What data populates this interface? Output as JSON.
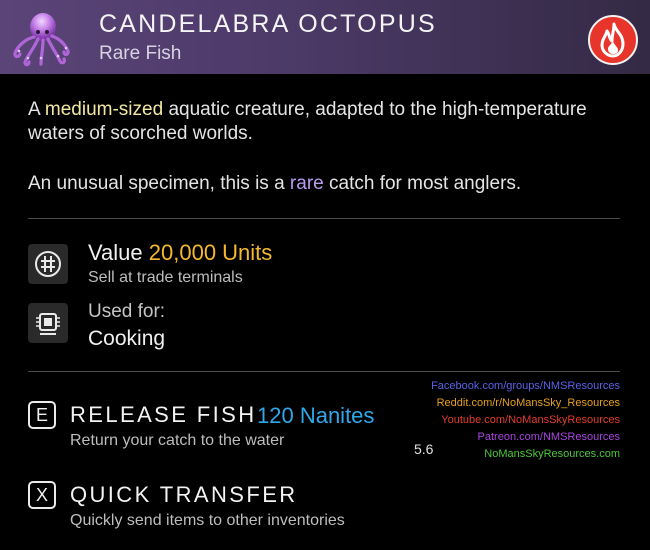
{
  "item": {
    "title": "CANDELABRA OCTOPUS",
    "subtitle": "Rare Fish",
    "icon": "octopus-icon",
    "badge_icon": "heat-flame-icon",
    "header_color": "#5b4478"
  },
  "description": {
    "p1_pre": "A ",
    "p1_hl": "medium-sized",
    "p1_post": " aquatic creature, adapted to the high-temperature waters of scorched worlds.",
    "p2_pre": "An unusual specimen, this is a ",
    "p2_hl": "rare",
    "p2_post": " catch for most anglers."
  },
  "value": {
    "label": "Value",
    "amount": "20,000 Units",
    "sub": "Sell at trade terminals",
    "icon": "units-currency-icon"
  },
  "used_for": {
    "label": "Used for:",
    "value": "Cooking",
    "icon": "nutrient-processor-icon"
  },
  "actions": [
    {
      "key": "E",
      "label": "RELEASE FISH",
      "sub": "Return your catch to the water",
      "reward": "120 Nanites"
    },
    {
      "key": "X",
      "label": "QUICK TRANSFER",
      "sub": "Quickly send items to other inventories"
    }
  ],
  "credits": [
    {
      "text": "Facebook.com/groups/NMSResources",
      "color": "#5a62e6"
    },
    {
      "text": "Reddit.com/r/NoMansSky_Resources",
      "color": "#e6a020"
    },
    {
      "text": "Youtube.com/NoMansSkyResources",
      "color": "#e23c2c"
    },
    {
      "text": "Patreon.com/NMSResources",
      "color": "#a845e0"
    },
    {
      "text": "NoMansSkyResources.com",
      "color": "#4cc838"
    }
  ],
  "version": "5.6",
  "colors": {
    "value_amount": "#f5b82e",
    "nanites": "#2fa8ea",
    "highlight_yellow": "#f2e7a2",
    "highlight_purple": "#b99bf0",
    "badge": "#e8352b"
  }
}
